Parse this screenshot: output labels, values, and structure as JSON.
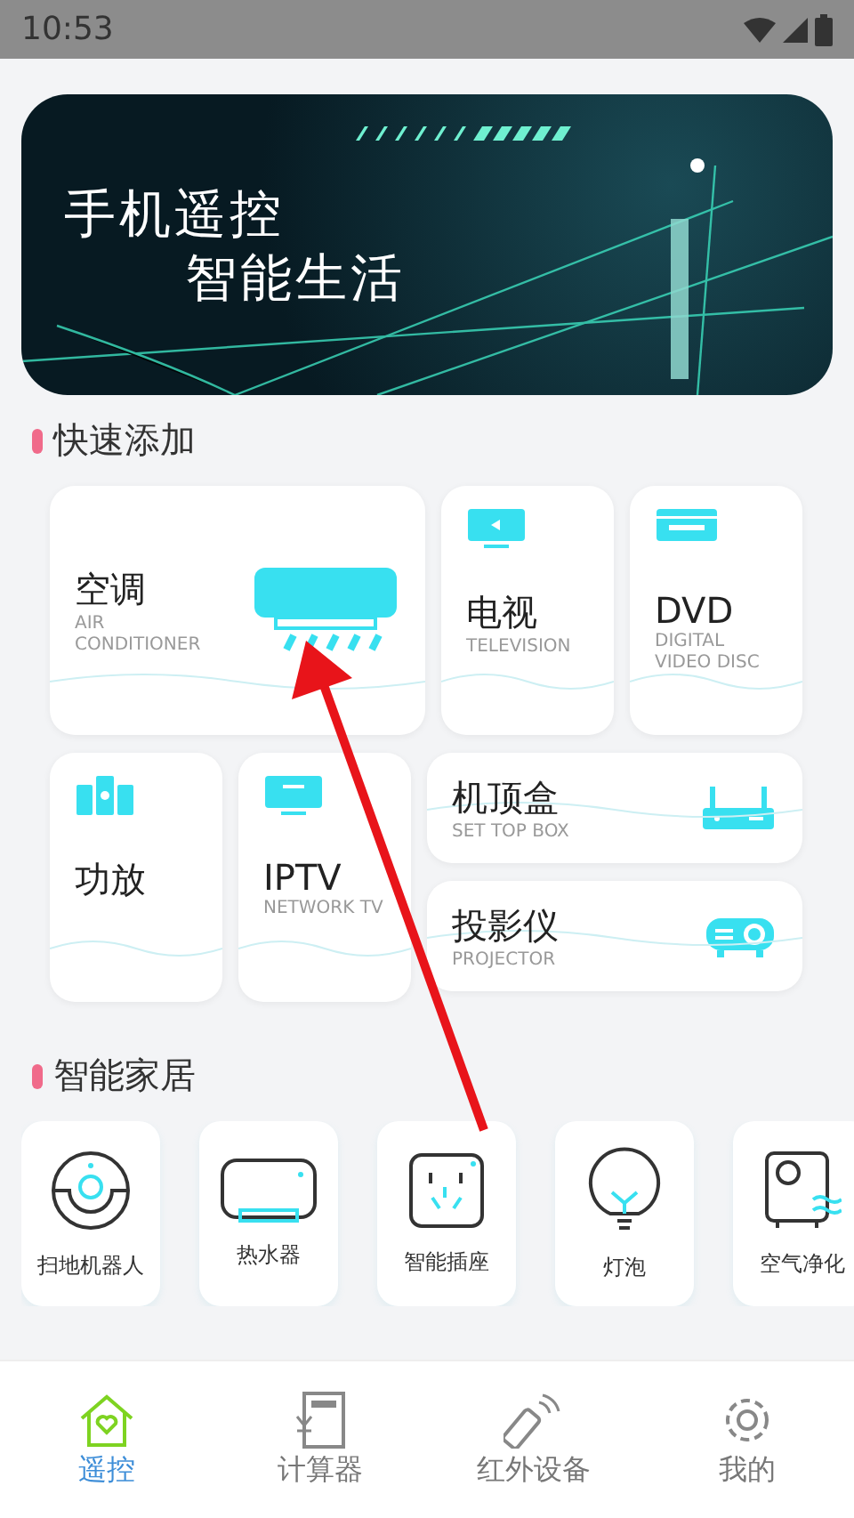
{
  "status_bar": {
    "time": "10:53"
  },
  "banner": {
    "line_1": "手机遥控",
    "line_2": "智能生活"
  },
  "quick_add": {
    "title": "快速添加",
    "devices": [
      {
        "kind": "large",
        "name": "空调",
        "subtitle": "AIR CONDITIONER"
      },
      {
        "kind": "tall",
        "name": "电视",
        "subtitle": "TELEVISION"
      },
      {
        "kind": "tall",
        "name": "DVD",
        "subtitle": "DIGITAL VIDEO DISC"
      },
      {
        "kind": "tall",
        "name": "功放"
      },
      {
        "kind": "tall",
        "name": "IPTV",
        "subtitle": "NETWORK TV"
      },
      {
        "kind": "wide",
        "name": "机顶盒",
        "subtitle": "SET TOP BOX"
      },
      {
        "kind": "wide",
        "name": "投影仪",
        "subtitle": "PROJECTOR"
      }
    ]
  },
  "smart_home": {
    "title": "智能家居",
    "items": [
      {
        "label": "扫地机器人"
      },
      {
        "label": "热水器"
      },
      {
        "label": "智能插座"
      },
      {
        "label": "灯泡"
      },
      {
        "label": "空气净化"
      }
    ]
  },
  "bottom_nav": [
    {
      "label": "遥控",
      "selected": true
    },
    {
      "label": "计算器",
      "selected": false
    },
    {
      "label": "红外设备",
      "selected": false
    },
    {
      "label": "我的",
      "selected": false
    }
  ]
}
